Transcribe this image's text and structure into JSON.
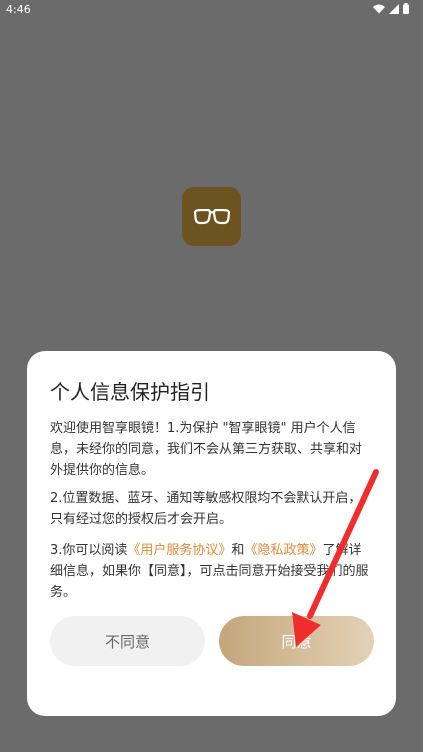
{
  "status_bar": {
    "time": "4:46",
    "icons": [
      "wifi-icon",
      "signal-icon",
      "battery-icon"
    ]
  },
  "app": {
    "logo_icon": "glasses-icon",
    "logo_color": "#6d5320"
  },
  "dialog": {
    "title": "个人信息保护指引",
    "para1": "欢迎使用智享眼镜！1.为保护 \"智享眼镜\" 用户个人信息，未经你的同意，我们不会从第三方获取、共享和对外提供你的信息。",
    "para2": "2.位置数据、蓝牙、通知等敏感权限均不会默认开启，只有经过您的授权后才会开启。",
    "para3": {
      "prefix": "3.你可以阅读",
      "link_user_agreement": "《用户服务协议》",
      "and": "和",
      "link_privacy_policy": "《隐私政策》",
      "suffix": "了解详细信息，如果你【同意】，可点击同意开始接受我们的服务。"
    },
    "decline_label": "不同意",
    "agree_label": "同意",
    "link_color": "#e08a3c"
  },
  "annotation": {
    "arrow_color": "#f02d2d"
  }
}
